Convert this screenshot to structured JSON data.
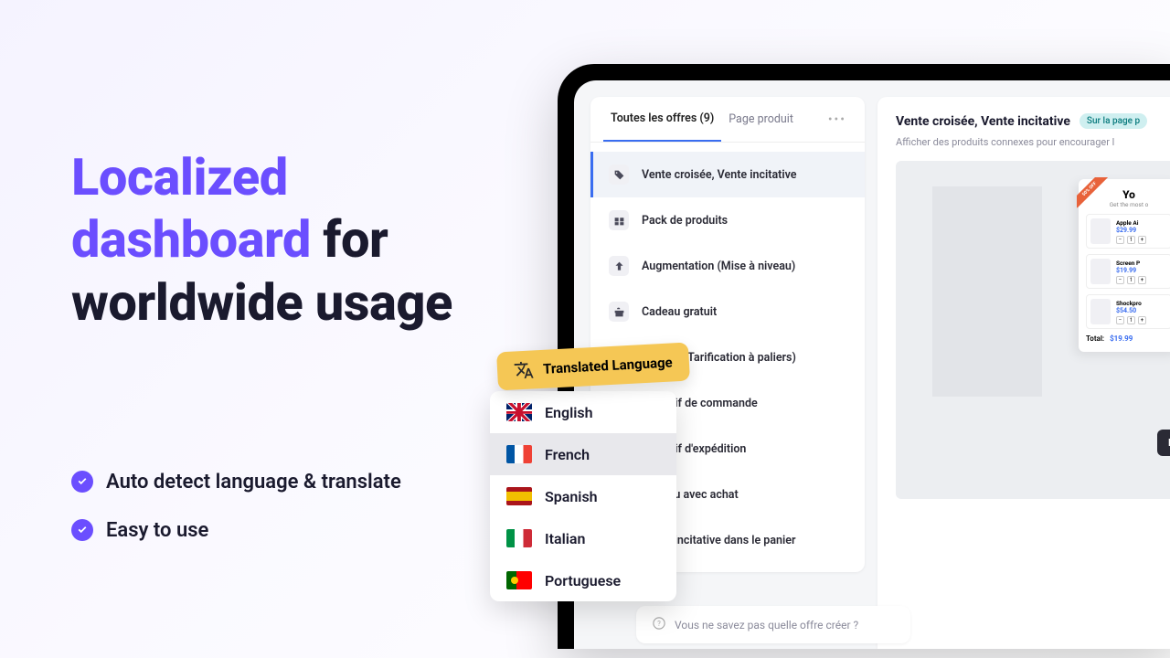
{
  "marketing": {
    "headline_accent": "Localized dashboard",
    "headline_rest": " for worldwide usage",
    "bullets": [
      "Auto detect language & translate",
      "Easy to use"
    ]
  },
  "tabs": {
    "all_offers": "Toutes les offres (9)",
    "product_page": "Page produit"
  },
  "offers": [
    "Vente croisée, Vente incitative",
    "Pack de produits",
    "Augmentation (Mise à niveau)",
    "Cadeau gratuit",
    "Volume (Tarification à paliers)",
    "Objectif de commande",
    "Objectif d'expédition",
    "Cadeau avec achat",
    "Vente incitative dans le panier"
  ],
  "help_text": "Vous ne savez pas quelle offre créer ?",
  "detail": {
    "title": "Vente croisée, Vente incitative",
    "badge": "Sur la page p",
    "subtitle": "Afficher des produits connexes pour encourager l",
    "mock_heading": "Yo",
    "mock_sub": "Get the most o",
    "products": [
      {
        "name": "Apple Ai",
        "price": "$29.99"
      },
      {
        "name": "Screen P",
        "price": "$19.99"
      },
      {
        "name": "Shockpro",
        "price": "$54.50"
      }
    ],
    "total_label": "Total:",
    "total_value": "$19.99"
  },
  "lang_pill": "Translated Language",
  "languages": [
    {
      "label": "English",
      "flag": "en"
    },
    {
      "label": "French",
      "flag": "fr"
    },
    {
      "label": "Spanish",
      "flag": "es"
    },
    {
      "label": "Italian",
      "flag": "it"
    },
    {
      "label": "Portuguese",
      "flag": "pt"
    }
  ],
  "selected_language": 1
}
